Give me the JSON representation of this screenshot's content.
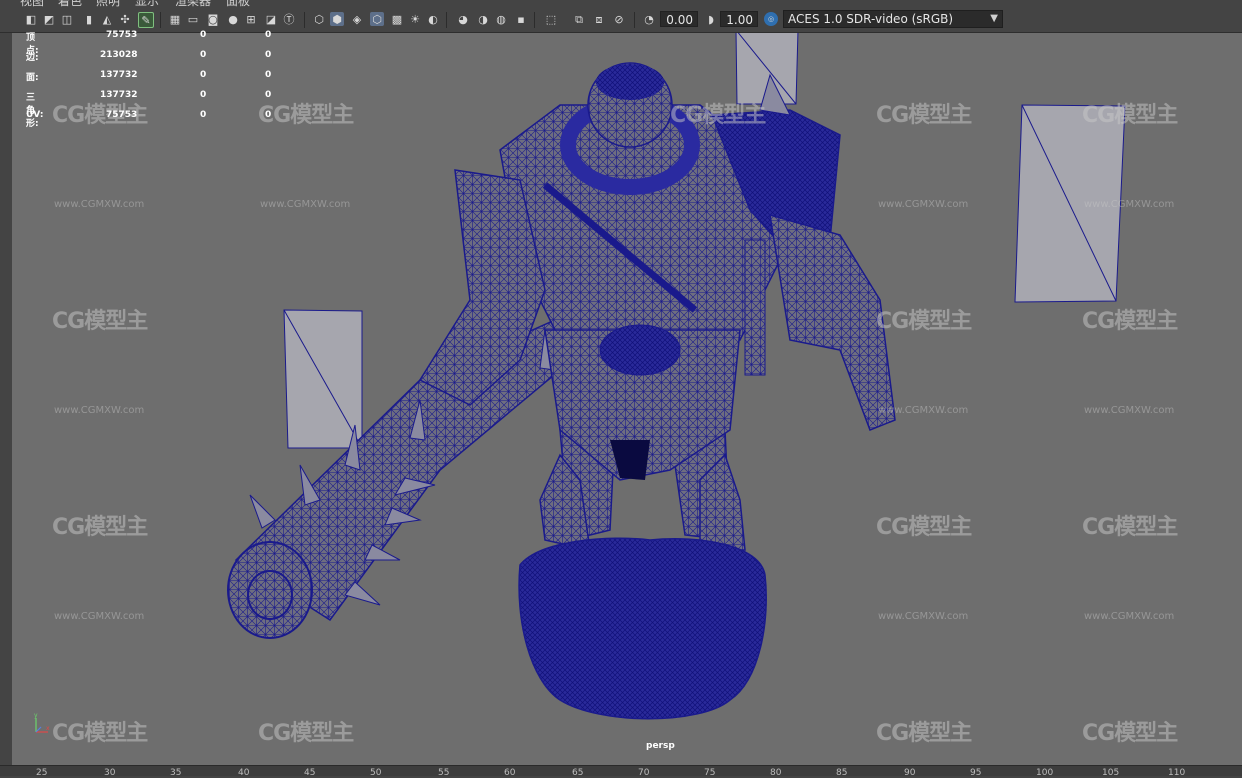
{
  "menu": [
    "视图",
    "着色",
    "照明",
    "显示",
    "渲染器",
    "面板"
  ],
  "toolbar": {
    "exposure_value": "0.00",
    "gamma_value": "1.00",
    "color_space": "ACES 1.0 SDR-video (sRGB)",
    "icons": [
      "camera-select-icon",
      "camera-lock-icon",
      "camera-attributes-icon",
      "bookmark-icon",
      "image-plane-icon",
      "pivot-icon",
      "grease-pencil-icon",
      "grid-icon",
      "film-gate-icon",
      "resolution-gate-icon",
      "gate-mask-icon",
      "field-chart-icon",
      "safe-action-icon",
      "safe-title-icon",
      "wireframe-icon",
      "smooth-shade-icon",
      "shade-wireframe-icon",
      "xray-icon",
      "textured-icon",
      "lights-icon",
      "shadows-icon",
      "ambient-occlusion-icon",
      "motion-blur-icon",
      "anti-alias-icon",
      "depth-of-field-icon",
      "isolate-select-icon",
      "xray-joints-icon",
      "xray-active-icon",
      "backface-icon",
      "exposure-icon",
      "gamma-icon",
      "color-management-icon"
    ]
  },
  "hud": {
    "rows": [
      {
        "label": "顶点:",
        "a": "75753",
        "b": "0",
        "c": "0"
      },
      {
        "label": "边:",
        "a": "213028",
        "b": "0",
        "c": "0"
      },
      {
        "label": "面:",
        "a": "137732",
        "b": "0",
        "c": "0"
      },
      {
        "label": "三角形:",
        "a": "137732",
        "b": "0",
        "c": "0"
      },
      {
        "label": "UV:",
        "a": "75753",
        "b": "0",
        "c": "0"
      }
    ]
  },
  "camera_label": "persp",
  "watermark": {
    "logo": "CG模型主",
    "url": "www.CGMXW.com"
  },
  "axis": {
    "y": "y",
    "x": "x"
  },
  "ruler_ticks": [
    "25",
    "30",
    "35",
    "40",
    "45",
    "50",
    "55",
    "60",
    "65",
    "70",
    "75",
    "80",
    "85",
    "90",
    "95",
    "100",
    "105",
    "110"
  ],
  "colors": {
    "viewport_bg": "#6e6e6e",
    "wire": "#1a1a8c",
    "ui_bg": "#444444"
  }
}
